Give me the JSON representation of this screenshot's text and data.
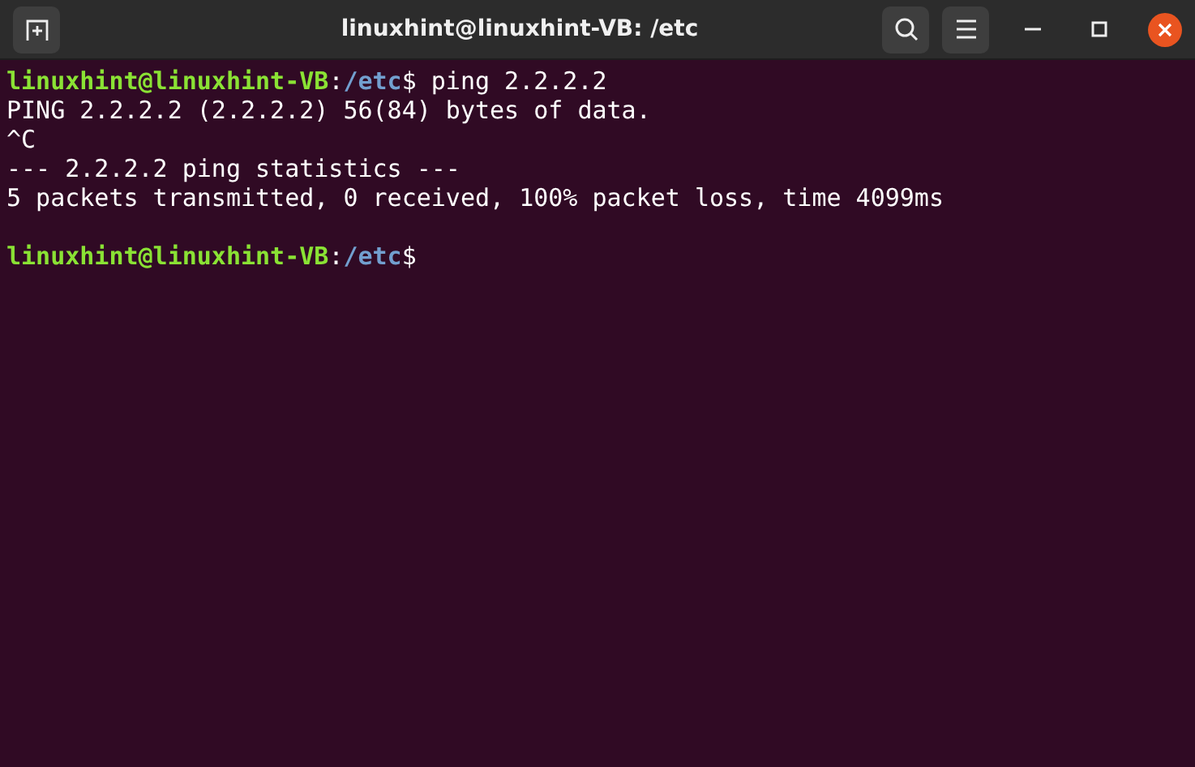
{
  "window": {
    "title": "linuxhint@linuxhint-VB: /etc"
  },
  "terminal": {
    "lines": [
      {
        "kind": "prompt",
        "user": "linuxhint@linuxhint-VB",
        "separator": ":",
        "path": "/etc",
        "symbol": "$",
        "command": "ping 2.2.2.2"
      },
      {
        "kind": "output",
        "text": "PING 2.2.2.2 (2.2.2.2) 56(84) bytes of data."
      },
      {
        "kind": "output",
        "text": "^C"
      },
      {
        "kind": "output",
        "text": "--- 2.2.2.2 ping statistics ---"
      },
      {
        "kind": "output",
        "text": "5 packets transmitted, 0 received, 100% packet loss, time 4099ms"
      },
      {
        "kind": "blank"
      },
      {
        "kind": "prompt",
        "user": "linuxhint@linuxhint-VB",
        "separator": ":",
        "path": "/etc",
        "symbol": "$"
      }
    ]
  }
}
